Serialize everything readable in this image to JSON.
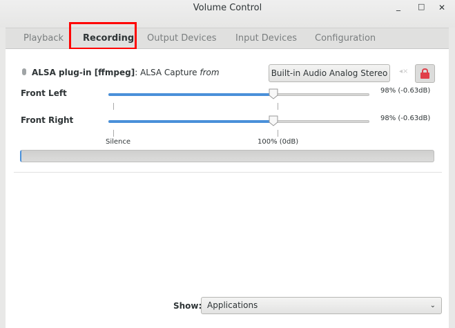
{
  "window": {
    "title": "Volume Control",
    "minimize": "_",
    "maximize": "□",
    "close": "✕"
  },
  "tabs": [
    {
      "label": "Playback"
    },
    {
      "label": "Recording",
      "active": true
    },
    {
      "label": "Output Devices"
    },
    {
      "label": "Input Devices"
    },
    {
      "label": "Configuration"
    }
  ],
  "stream": {
    "app_name": "ALSA plug-in [ffmpeg]",
    "separator": ":",
    "stream_name": "ALSA Capture",
    "from": "from",
    "device": "Built-in Audio Analog Stereo",
    "locked": true,
    "channels": [
      {
        "label": "Front Left",
        "value": "98% (-0.63dB)",
        "percent": 98
      },
      {
        "label": "Front Right",
        "value": "98% (-0.63dB)",
        "percent": 98
      }
    ],
    "scale": {
      "silence": "Silence",
      "hundred": "100% (0dB)"
    },
    "level_percent": 0
  },
  "footer": {
    "show_label": "Show:",
    "show_value": "Applications"
  },
  "colors": {
    "accent": "#4a90d9",
    "lock": "#e0404a",
    "highlight": "#ff0000"
  }
}
